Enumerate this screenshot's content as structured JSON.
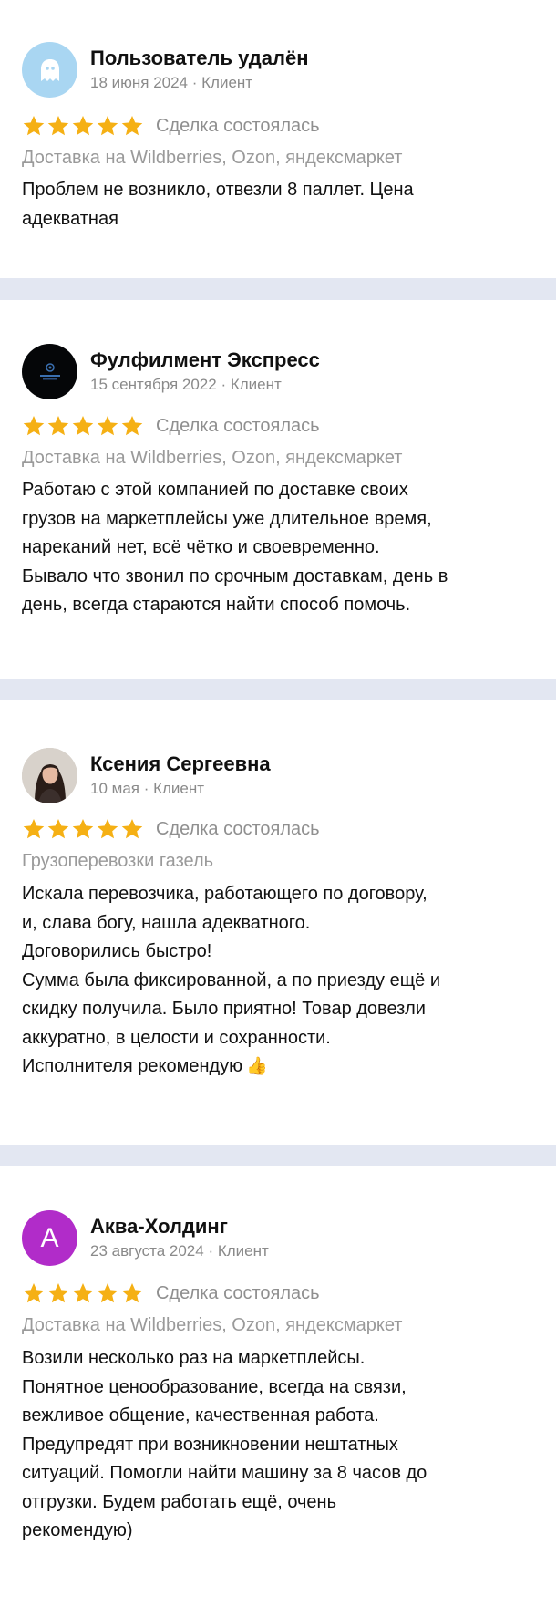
{
  "reviews": [
    {
      "name": "Пользователь удалён",
      "date": "18 июня 2024",
      "role": "Клиент",
      "avatar_icon": "ghost-icon",
      "rating": 5,
      "deal_status": "Сделка состоялась",
      "category": "Доставка на Wildberries, Ozon, яндексмаркет",
      "text_lines": [
        "Проблем не возникло, отвезли 8 паллет. Цена",
        "адекватная"
      ]
    },
    {
      "name": "Фулфилмент Экспресс",
      "date": "15 сентября 2022",
      "role": "Клиент",
      "avatar_icon": "company-logo-icon",
      "rating": 5,
      "deal_status": "Сделка состоялась",
      "category": "Доставка на Wildberries, Ozon, яндексмаркет",
      "text_lines": [
        "Работаю с этой компанией по доставке своих",
        "грузов на маркетплейсы уже длительное время,",
        "нареканий нет, всё чётко и своевременно.",
        "Бывало что звонил по срочным доставкам, день в",
        "день, всегда стараются найти способ помочь."
      ]
    },
    {
      "name": "Ксения Сергеевна",
      "date": "10 мая",
      "role": "Клиент",
      "avatar_icon": "user-photo-icon",
      "rating": 5,
      "deal_status": "Сделка состоялась",
      "category": "Грузоперевозки газель",
      "text_lines": [
        "Искала перевозчика, работающего по договору,",
        "и, слава богу, нашла адекватного.",
        "Договорились быстро!",
        "Сумма была фиксированной, а по приезду ещё и",
        "скидку получила. Было приятно! Товар довезли",
        "аккуратно, в целости и сохранности.",
        "Исполнителя рекомендую"
      ],
      "text_emoji": "👍"
    },
    {
      "name": "Аква-Холдинг",
      "date": "23 августа 2024",
      "role": "Клиент",
      "avatar_letter": "А",
      "rating": 5,
      "deal_status": "Сделка состоялась",
      "category": "Доставка на Wildberries, Ozon, яндексмаркет",
      "text_lines": [
        "Возили несколько раз на маркетплейсы.",
        "Понятное ценообразование, всегда на связи,",
        "вежливое общение, качественная работа.",
        "Предупредят при возникновении нештатных",
        "ситуаций. Помогли найти машину за 8 часов до",
        "отгрузки. Будем работать ещё, очень",
        "рекомендую)"
      ]
    }
  ],
  "colors": {
    "page_background": "#e3e7f2",
    "card_background": "#ffffff",
    "star": "#f5b014",
    "muted_text": "#8f8f8f",
    "avatar_letter_bg": "#b12cc9",
    "avatar_ghost_bg": "#a9d6f2"
  }
}
